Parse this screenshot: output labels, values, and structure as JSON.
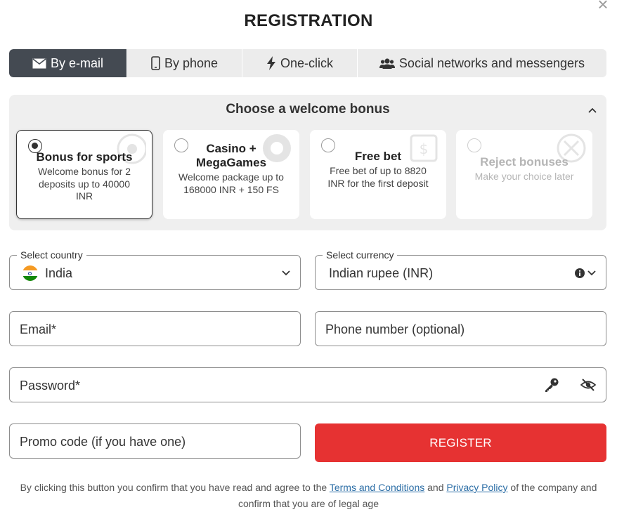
{
  "dialog": {
    "title": "REGISTRATION",
    "close_icon": "close-icon"
  },
  "tabs": [
    {
      "label": "By e-mail",
      "icon": "envelope-icon",
      "active": true
    },
    {
      "label": "By phone",
      "icon": "phone-icon",
      "active": false
    },
    {
      "label": "One-click",
      "icon": "lightning-icon",
      "active": false
    },
    {
      "label": "Social networks and messengers",
      "icon": "users-icon",
      "active": false
    }
  ],
  "bonus": {
    "heading": "Choose a welcome bonus",
    "cards": [
      {
        "title": "Bonus for sports",
        "desc": "Welcome bonus for 2 deposits up to 40000 INR",
        "selected": true
      },
      {
        "title": "Casino + MegaGames",
        "desc": "Welcome package up to 168000 INR + 150 FS",
        "selected": false
      },
      {
        "title": "Free bet",
        "desc": "Free bet of up to 8820 INR for the first deposit",
        "selected": false
      },
      {
        "title": "Reject bonuses",
        "desc": "Make your choice later",
        "selected": false
      }
    ]
  },
  "form": {
    "country": {
      "label": "Select country",
      "value": "India"
    },
    "currency": {
      "label": "Select currency",
      "value": "Indian rupee (INR)"
    },
    "email": {
      "placeholder": "Email*"
    },
    "phone": {
      "placeholder": "Phone number (optional)"
    },
    "password": {
      "placeholder": "Password*"
    },
    "promo": {
      "placeholder": "Promo code (if you have one)"
    },
    "register_label": "REGISTER"
  },
  "legal": {
    "before": "By clicking this button you confirm that you have read and agree to the",
    "terms": "Terms and Conditions",
    "and": "and",
    "privacy": "Privacy Policy",
    "after": "of the company and confirm that you are of legal age"
  },
  "colors": {
    "accent": "#e63232",
    "tab_active": "#444a52",
    "link": "#2c6ea6"
  }
}
